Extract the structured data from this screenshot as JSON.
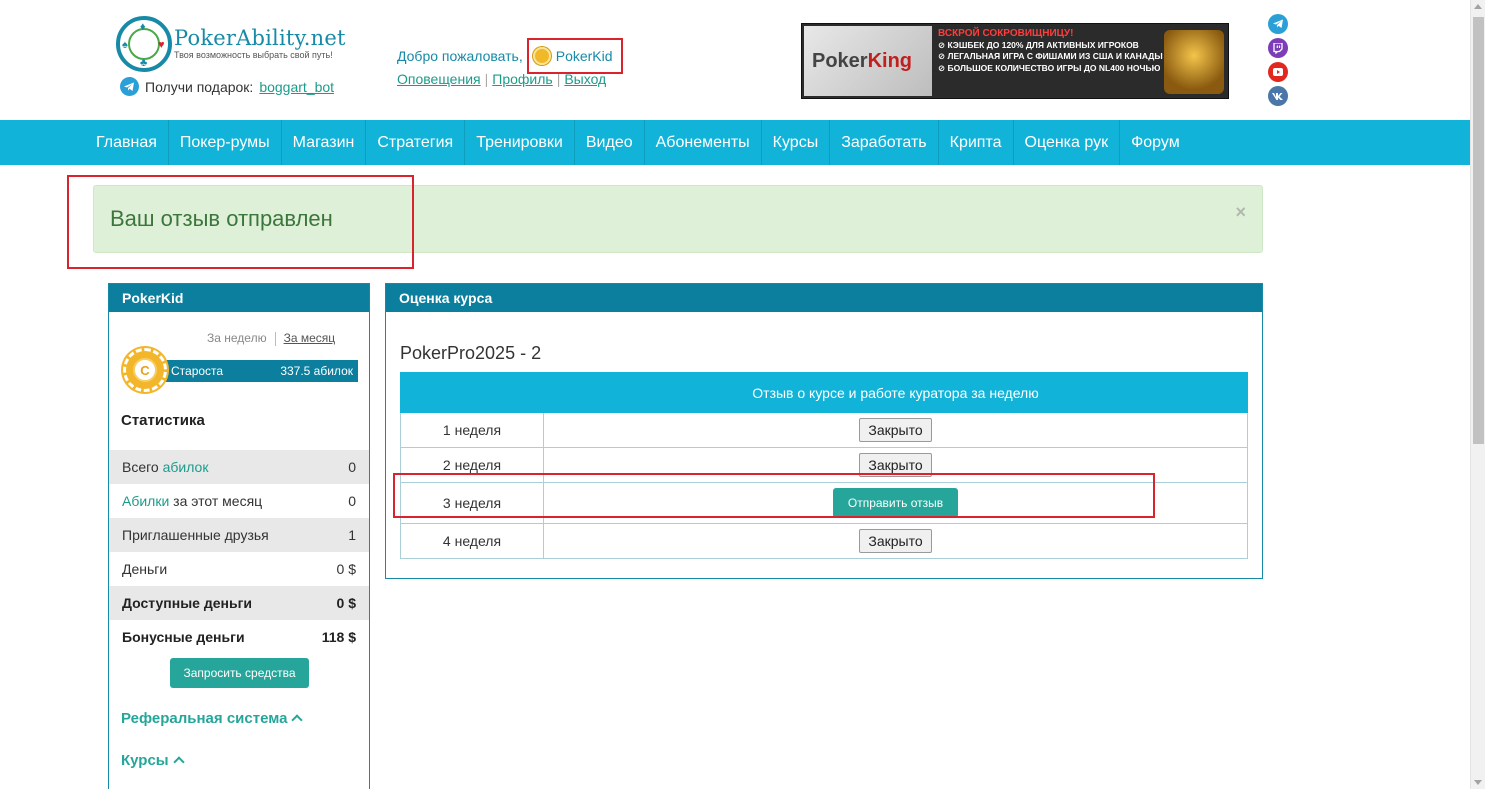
{
  "header": {
    "logo_name": "PokerAbility",
    "logo_suffix": ".net",
    "logo_tagline": "Твоя возможность выбрать свой путь!",
    "gift_text": "Получи подарок:",
    "gift_link": "boggart_bot",
    "welcome_text": "Добро пожаловать,",
    "username": "PokerKid",
    "links": [
      "Оповещения",
      "Профиль",
      "Выход"
    ]
  },
  "banner": {
    "brand_a": "Poker",
    "brand_b": "King",
    "lines": [
      "ВСКРОЙ СОКРОВИЩНИЦУ!",
      "⊘ КЭШБЕК ДО 120% ДЛЯ АКТИВНЫХ ИГРОКОВ",
      "⊘ ЛЕГАЛЬНАЯ ИГРА С ФИШАМИ ИЗ США И КАНАДЫ",
      "⊘ БОЛЬШОЕ КОЛИЧЕСТВО ИГРЫ ДО NL400 НОЧЬЮ"
    ]
  },
  "nav": [
    "Главная",
    "Покер-румы",
    "Магазин",
    "Стратегия",
    "Тренировки",
    "Видео",
    "Абонементы",
    "Курсы",
    "Заработать",
    "Крипта",
    "Оценка рук",
    "Форум"
  ],
  "alert": {
    "text": "Ваш отзыв отправлен",
    "close": "×"
  },
  "sidebar": {
    "title": "PokerKid",
    "period_week": "За неделю",
    "period_month": "За месяц",
    "coin_letter": "C",
    "rank": "Староста",
    "rank_value": "337.5 абилок",
    "stats_title": "Статистика",
    "stats": [
      {
        "pre": "Всего ",
        "link": "абилок",
        "post": "",
        "value": "0"
      },
      {
        "pre": "",
        "link": "Абилки",
        "post": " за этот месяц",
        "value": "0"
      },
      {
        "pre": "Приглашенные друзья",
        "link": "",
        "post": "",
        "value": "1"
      },
      {
        "pre": "Деньги",
        "link": "",
        "post": "",
        "value": "0 $"
      },
      {
        "pre": "Доступные деньги",
        "link": "",
        "post": "",
        "value": "0 $"
      },
      {
        "pre": "Бонусные деньги",
        "link": "",
        "post": "",
        "value": "118 $"
      }
    ],
    "request_button": "Запросить средства",
    "referral": "Реферальная система",
    "courses": "Курсы"
  },
  "main": {
    "panel_title": "Оценка курса",
    "course_title": "PokerPro2025 - 2",
    "table_header": "Отзыв о курсе и работе куратора за неделю",
    "rows": [
      {
        "week": "1 неделя",
        "action": "Закрыто"
      },
      {
        "week": "2 неделя",
        "action": "Закрыто"
      },
      {
        "week": "3 неделя",
        "action": "Отправить отзыв"
      },
      {
        "week": "4 неделя",
        "action": "Закрыто"
      }
    ]
  },
  "colors": {
    "nav": "#12b3d8",
    "panel_head": "#0b7f9d",
    "teal": "#26a69a",
    "highlight": "#d9232d",
    "alert_bg": "#dff0d8"
  },
  "icons": [
    "telegram-icon",
    "twitch-icon",
    "youtube-icon",
    "vk-icon",
    "coin-icon",
    "close-icon",
    "chevron-up-icon"
  ]
}
